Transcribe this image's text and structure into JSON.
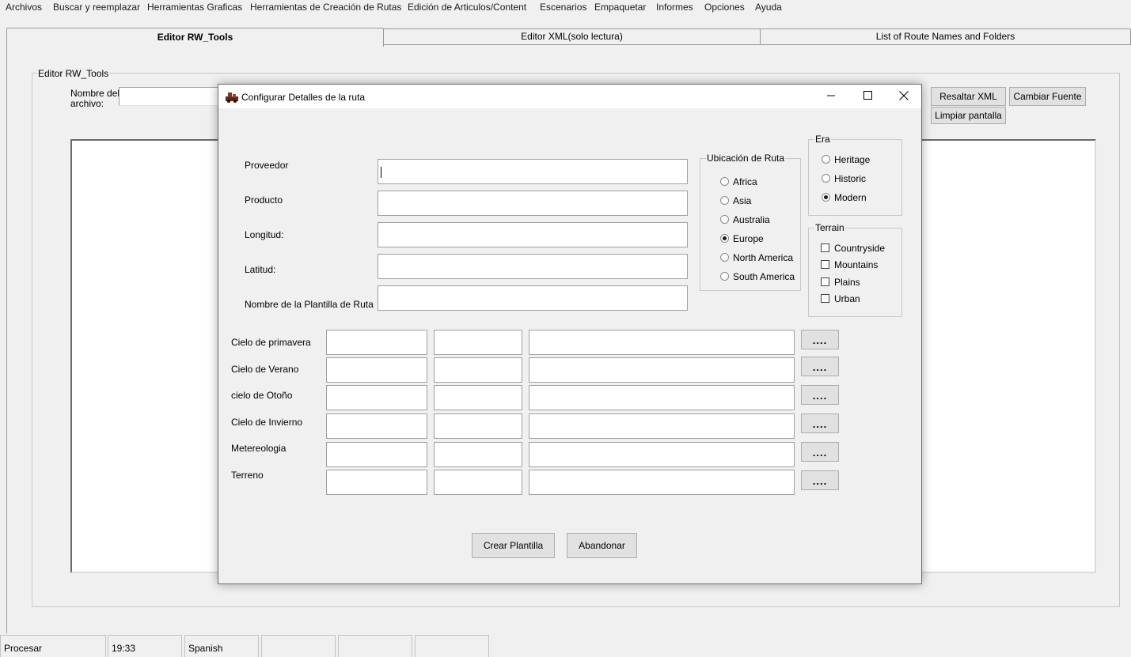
{
  "menu": [
    "Archivos",
    "Buscar y reemplazar",
    "Herramientas Graficas",
    "Herramientas de Creación de Rutas",
    "Edición de Articulos/Content",
    "Escenarios",
    "Empaquetar",
    "Informes",
    "Opciones",
    "Ayuda"
  ],
  "tabs": [
    "Editor RW_Tools",
    "Editor XML(solo lectura)",
    "List of Route Names and Folders"
  ],
  "editor": {
    "group_label": "Editor RW_Tools",
    "filename_label_1": "Nombre del",
    "filename_label_2": "archivo:",
    "filename_value": "",
    "highlight_xml": "Resaltar XML",
    "change_font": "Cambiar Fuente",
    "clear_screen": "Limpiar pantalla"
  },
  "dialog": {
    "title": "Configurar Detalles de la ruta",
    "fields": [
      {
        "label": "Proveedor",
        "value": ""
      },
      {
        "label": "Producto",
        "value": ""
      },
      {
        "label": "Longitud:",
        "value": ""
      },
      {
        "label": "Latitud:",
        "value": ""
      },
      {
        "label": "Nombre de la Plantilla de Ruta",
        "value": ""
      }
    ],
    "location": {
      "label": "Ubicación de Ruta",
      "options": [
        "Africa",
        "Asia",
        "Australia",
        "Europe",
        "North America",
        "South America"
      ],
      "selected": "Europe"
    },
    "era": {
      "label": "Era",
      "options": [
        "Heritage",
        "Historic",
        "Modern"
      ],
      "selected": "Modern"
    },
    "terrain": {
      "label": "Terrain",
      "options": [
        "Countryside",
        "Mountains",
        "Plains",
        "Urban"
      ]
    },
    "rows": [
      {
        "label": "Cielo de primavera",
        "browse": "...."
      },
      {
        "label": "Cielo de Verano",
        "browse": "...."
      },
      {
        "label": "cielo de Otoño",
        "browse": "...."
      },
      {
        "label": "Cielo de Invierno",
        "browse": "...."
      },
      {
        "label": "Metereologia",
        "browse": "...."
      },
      {
        "label": "Terreno",
        "browse": "...."
      }
    ],
    "create_button": "Crear Plantilla",
    "abort_button": "Abandonar"
  },
  "statusbar": [
    "Procesar",
    "19:33",
    "Spanish",
    "",
    "",
    ""
  ]
}
